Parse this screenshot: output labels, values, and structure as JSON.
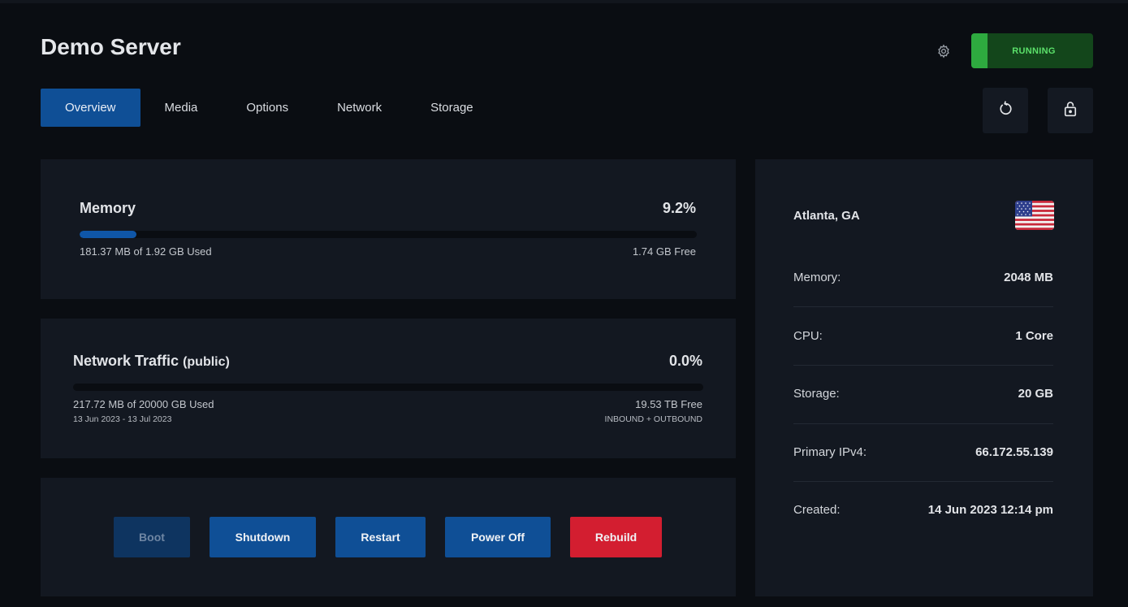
{
  "server": {
    "title": "Demo Server",
    "status": "RUNNING"
  },
  "tabs": [
    {
      "label": "Overview",
      "active": true
    },
    {
      "label": "Media",
      "active": false
    },
    {
      "label": "Options",
      "active": false
    },
    {
      "label": "Network",
      "active": false
    },
    {
      "label": "Storage",
      "active": false
    }
  ],
  "memory": {
    "label": "Memory",
    "percent": "9.2%",
    "percent_value": 0.092,
    "used": "181.37 MB of 1.92 GB Used",
    "free": "1.74 GB Free"
  },
  "network": {
    "label": "Network Traffic",
    "label_sub": "(public)",
    "percent": "0.0%",
    "percent_value": 0.0,
    "used": "217.72 MB of 20000 GB Used",
    "free": "19.53 TB Free",
    "period": "13 Jun 2023 - 13 Jul 2023",
    "direction": "INBOUND + OUTBOUND"
  },
  "actions": {
    "boot": "Boot",
    "shutdown": "Shutdown",
    "restart": "Restart",
    "power_off": "Power Off",
    "rebuild": "Rebuild"
  },
  "info": {
    "location": "Atlanta, GA",
    "flag": "us-flag",
    "memory_label": "Memory:",
    "memory_value": "2048 MB",
    "cpu_label": "CPU:",
    "cpu_value": "1 Core",
    "storage_label": "Storage:",
    "storage_value": "20 GB",
    "ipv4_label": "Primary IPv4:",
    "ipv4_value": "66.172.55.139",
    "created_label": "Created:",
    "created_value": "14 Jun 2023 12:14 pm"
  },
  "icons": {
    "settings": "gear-icon",
    "reload": "reload-icon",
    "lock": "lock-icon"
  },
  "colors": {
    "accent": "#0f4f96",
    "running": "#2eaa3f",
    "danger": "#d31e30"
  }
}
